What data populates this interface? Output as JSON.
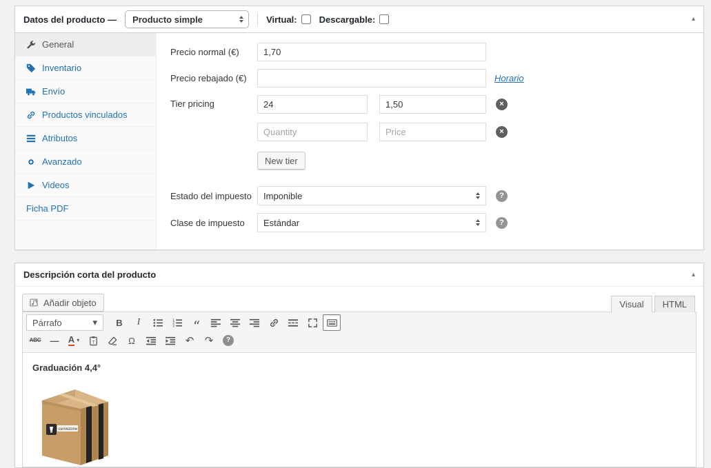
{
  "colors": {
    "accent": "#2271b1",
    "panel_border": "#ccd0d4",
    "page_bg": "#f1f1f1"
  },
  "icons": {
    "collapse": "▴",
    "dropdown": "▾",
    "remove": "×",
    "help": "?",
    "bold": "B",
    "italic": "I",
    "blockquote": "“",
    "strikethrough": "ABC",
    "hr": "—",
    "text_color": "A",
    "omega": "Ω",
    "undo": "↶",
    "redo": "↷"
  },
  "product_panel": {
    "title": "Datos del producto —",
    "type_select": "Producto simple",
    "virtual_label": "Virtual:",
    "downloadable_label": "Descargable:",
    "tabs": [
      {
        "label": "General",
        "icon": "wrench-icon",
        "active": true
      },
      {
        "label": "Inventario",
        "icon": "tag-icon"
      },
      {
        "label": "Envío",
        "icon": "truck-icon"
      },
      {
        "label": "Productos vinculados",
        "icon": "link-icon"
      },
      {
        "label": "Atributos",
        "icon": "attributes-icon"
      },
      {
        "label": "Avanzado",
        "icon": "gear-icon"
      },
      {
        "label": "Videos",
        "icon": "video-icon"
      },
      {
        "label": "Ficha PDF",
        "icon": ""
      }
    ],
    "fields": {
      "regular_price_label": "Precio normal (€)",
      "regular_price_value": "1,70",
      "sale_price_label": "Precio rebajado (€)",
      "sale_price_value": "",
      "schedule_link": "Horario",
      "tier_pricing_label": "Tier pricing",
      "tier_rows": [
        {
          "quantity": "24",
          "price": "1,50"
        },
        {
          "quantity_placeholder": "Quantity",
          "price_placeholder": "Price"
        }
      ],
      "new_tier_button": "New tier",
      "tax_status_label": "Estado del impuesto",
      "tax_status_value": "Imponible",
      "tax_class_label": "Clase de impuesto",
      "tax_class_value": "Estándar"
    }
  },
  "short_description_panel": {
    "title": "Descripción corta del producto",
    "add_media_button": "Añadir objeto",
    "tabs": [
      {
        "label": "Visual",
        "active": true
      },
      {
        "label": "HTML",
        "active": false
      }
    ],
    "toolbar": {
      "paragraph_select": "Párrafo"
    },
    "content": {
      "heading": "Graduación 4,4°",
      "image_logo_text": "cervezone"
    }
  }
}
